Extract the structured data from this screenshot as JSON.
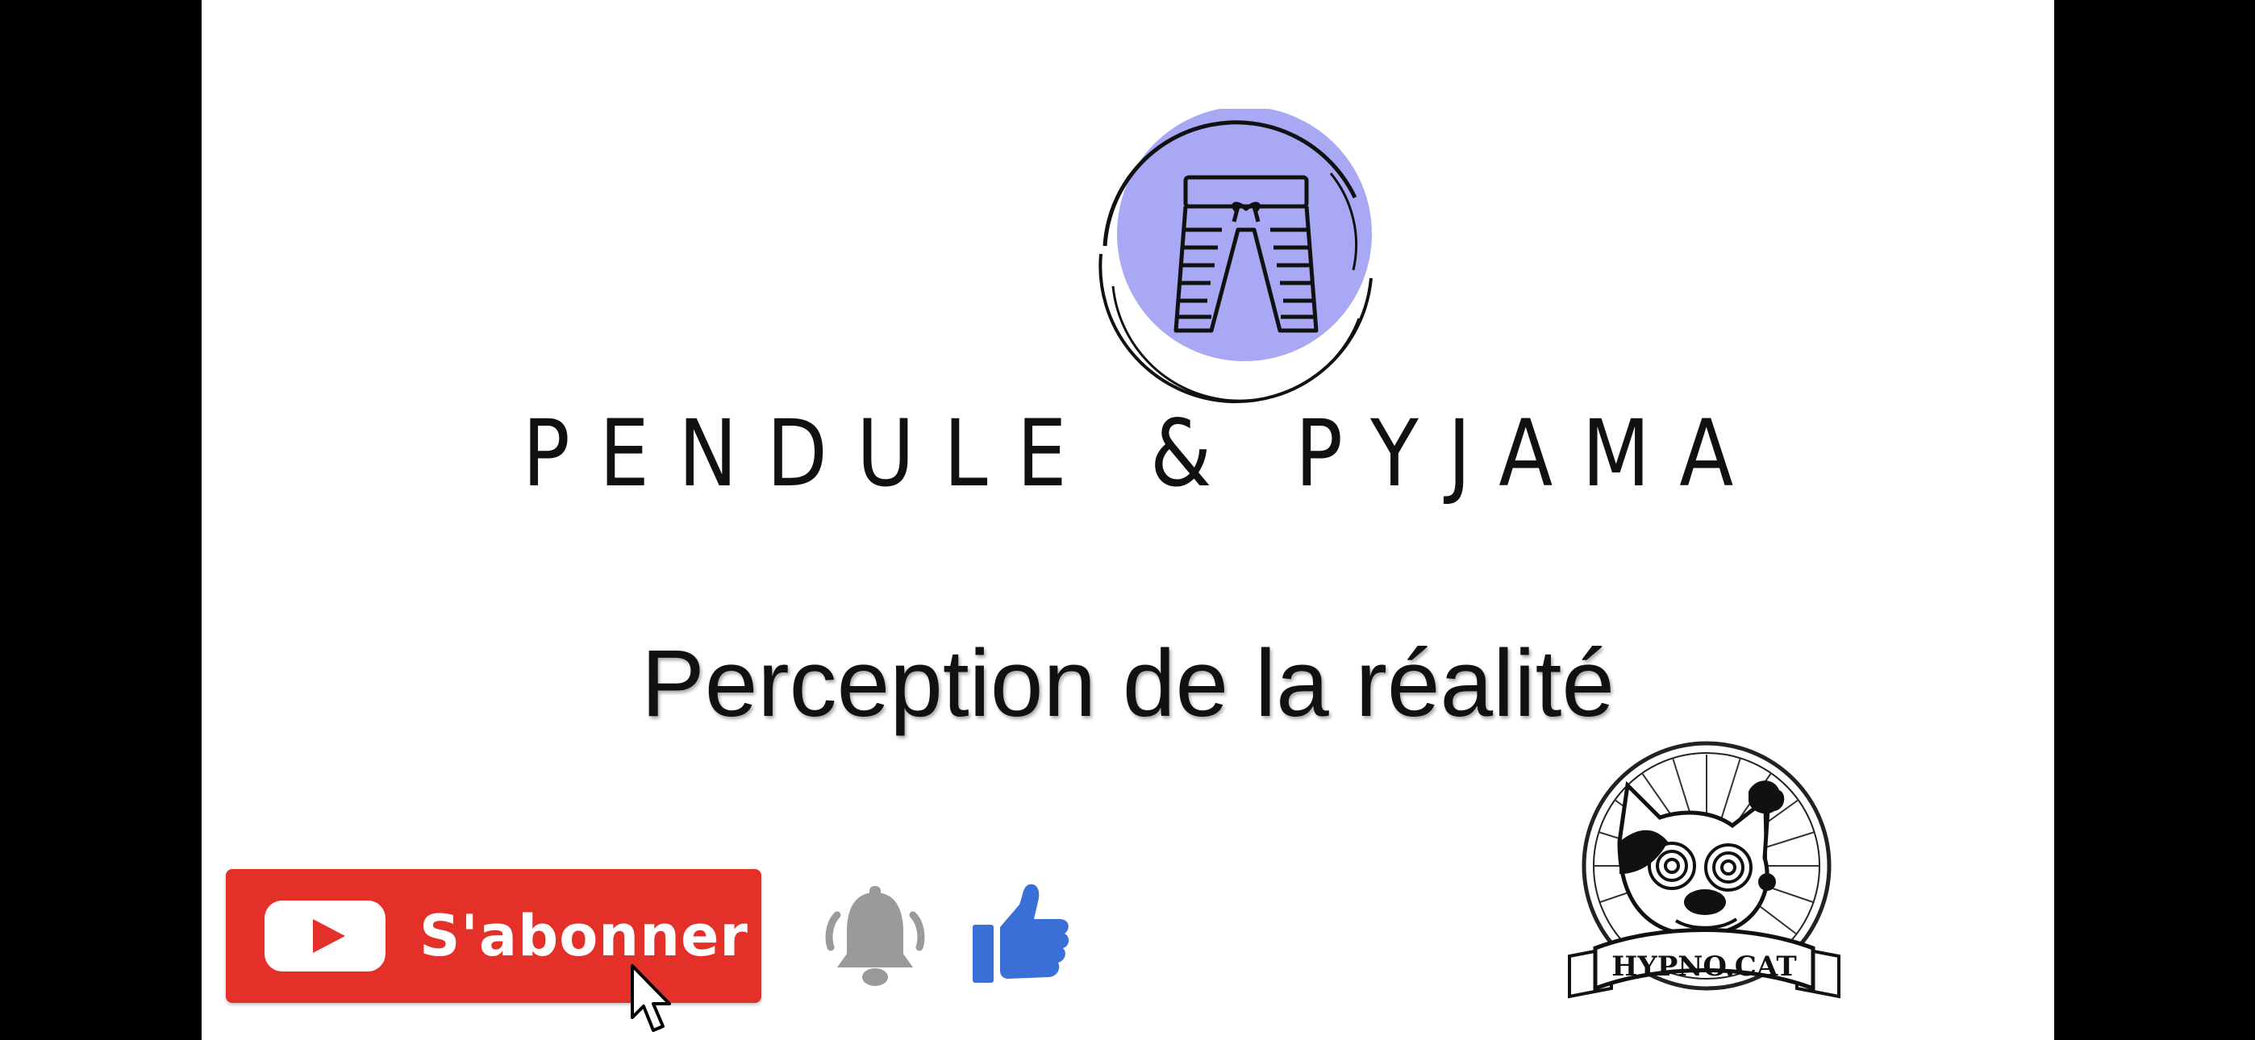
{
  "brand": {
    "name": "PENDULE & PYJAMA",
    "logo_icon": "pajama-pants-icon",
    "logo_circle_color": "#a8a8f4"
  },
  "episode": {
    "title": "Perception de la réalité"
  },
  "actions": {
    "subscribe_label": "S'abonner",
    "subscribe_color": "#e3312a",
    "bell_icon": "notification-bell-icon",
    "bell_color": "#9a9a9a",
    "like_icon": "thumbs-up-icon",
    "like_color": "#3b6fd8"
  },
  "badge": {
    "label": "HYPNO.CAT",
    "icon": "hypno-cat-badge-icon"
  }
}
